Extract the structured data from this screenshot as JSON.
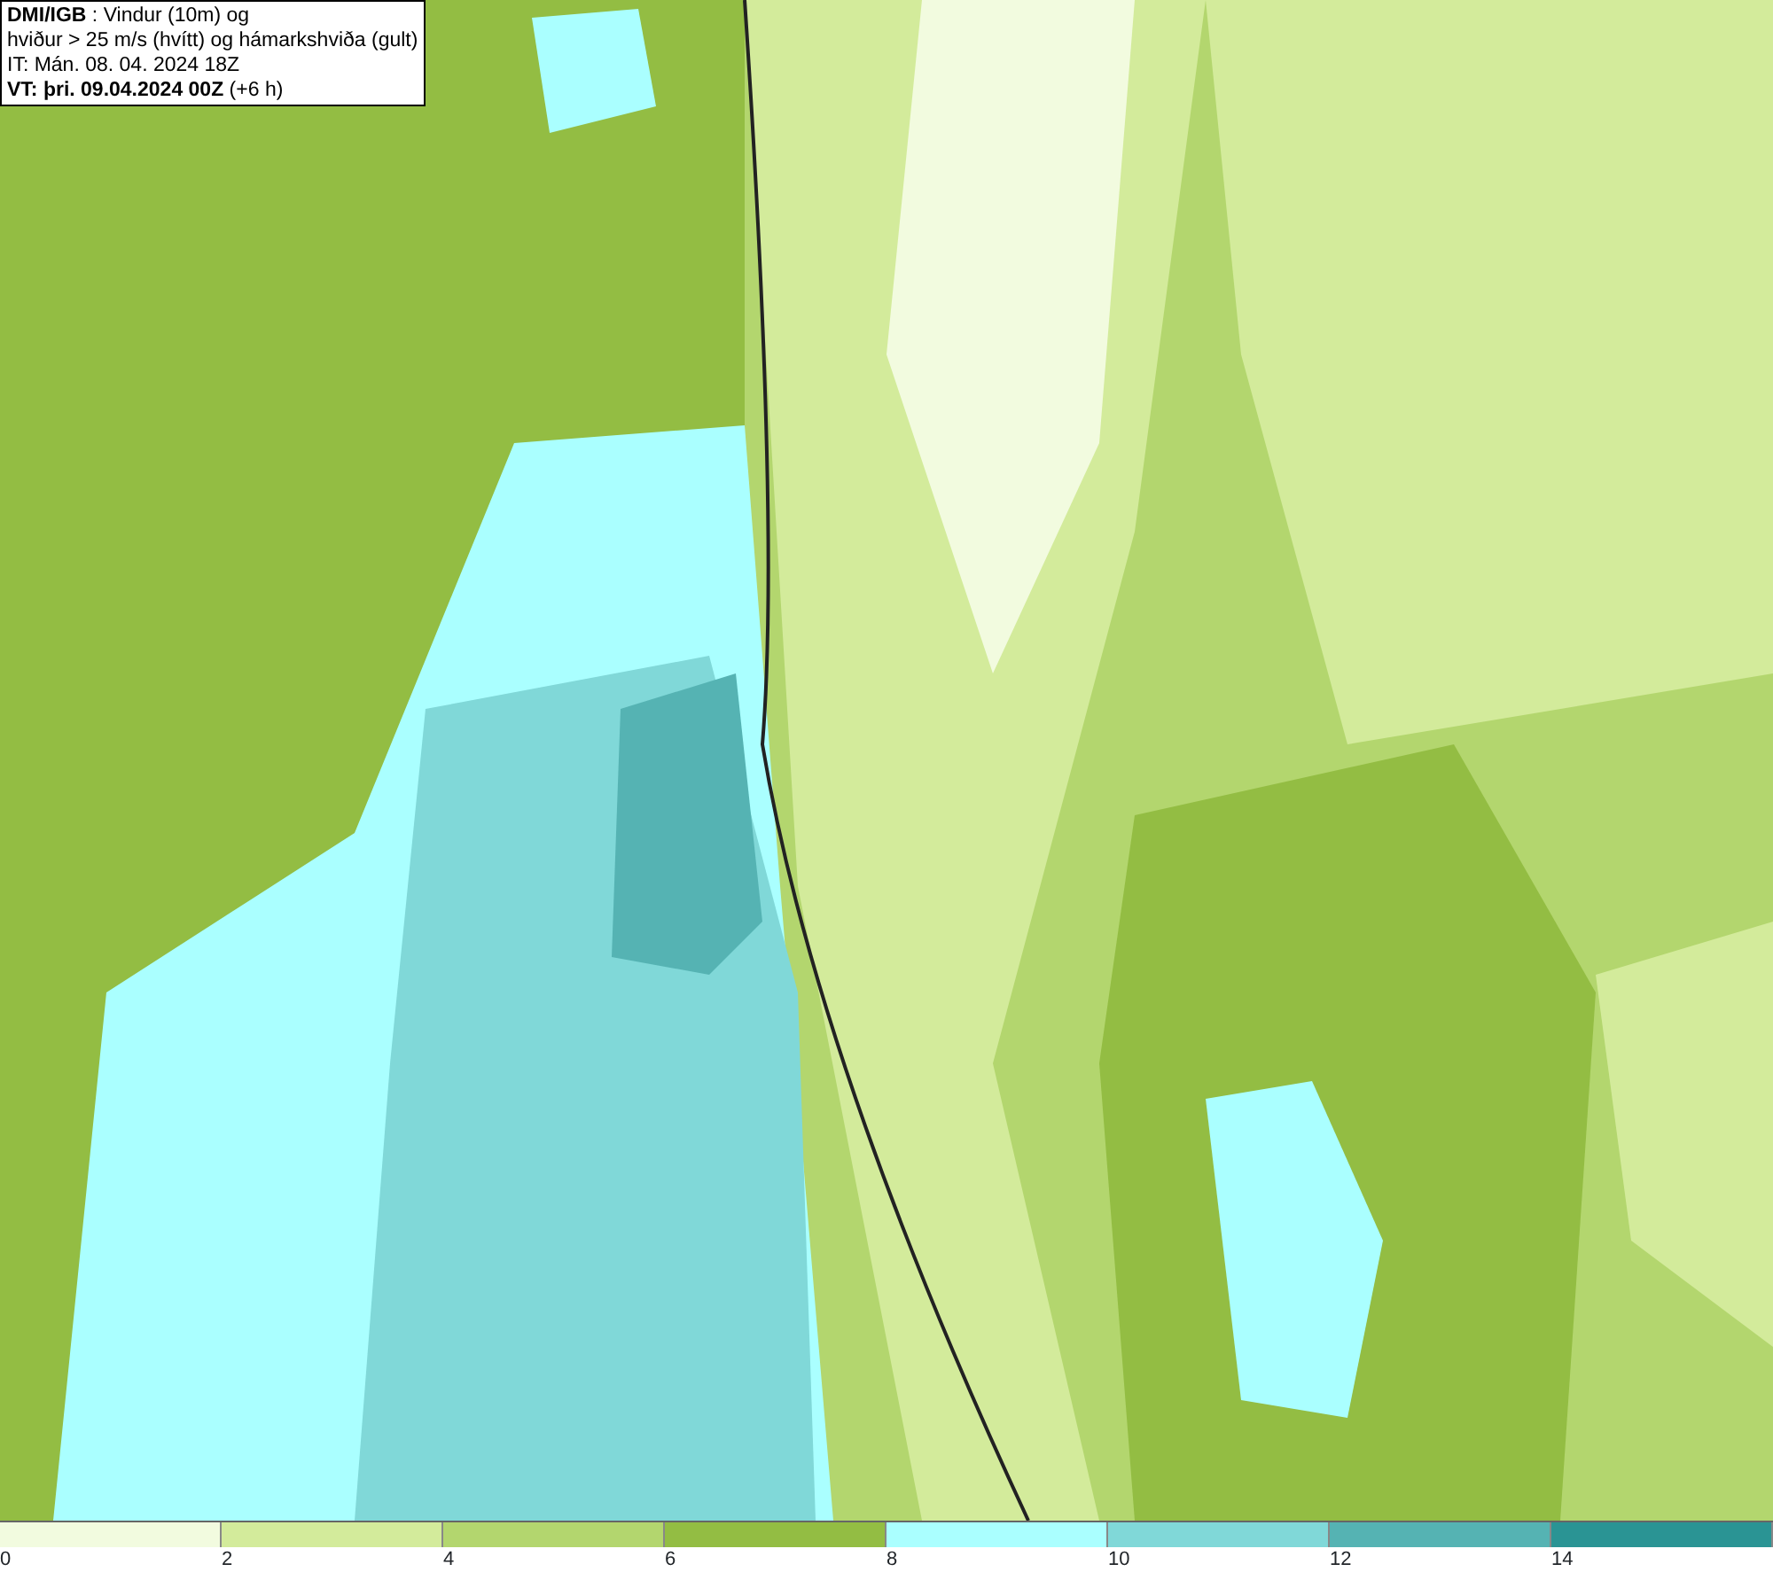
{
  "header": {
    "lines": [
      "**DMI/IGB** : Vindur (10m) og",
      "hviður > 25 m/s (hvítt) og hámarkshviða (gult)",
      "IT: Mán. 08. 04. 2024 18Z",
      "**VT: þri. 09.04.2024 00Z** (+6 h)"
    ]
  },
  "legend": {
    "bins": [
      {
        "color": "#f2fbdf"
      },
      {
        "color": "#d3eb9b"
      },
      {
        "color": "#b3d66e"
      },
      {
        "color": "#93bd43"
      },
      {
        "color": "#aaffff"
      },
      {
        "color": "#80d8d8"
      },
      {
        "color": "#55b3b3"
      },
      {
        "color": "#2a9494"
      }
    ],
    "ticks": [
      "0",
      "2",
      "4",
      "6",
      "8",
      "10",
      "12",
      "14"
    ]
  }
}
